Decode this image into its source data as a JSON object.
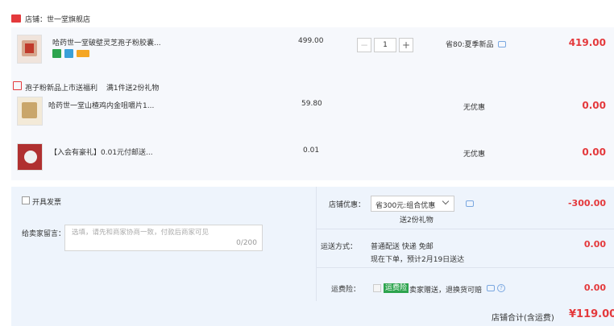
{
  "store": {
    "icon": "store-icon",
    "name": "店铺：世一堂旗舰店"
  },
  "items": [
    {
      "name": "哈药世一堂破壁灵芝孢子粉胶囊...",
      "price": "499.00",
      "quantity": "1",
      "promo": "省80:夏季新品",
      "subtotal": "419.00",
      "badges": [
        "7天",
        "保障",
        "卡"
      ]
    },
    {
      "name": "哈药世一堂山楂鸡内金咀嚼片1...",
      "price": "59.80",
      "promo": "无优惠",
      "subtotal": "0.00"
    },
    {
      "name": "【入会有豪礼】0.01元付邮送...",
      "price": "0.01",
      "promo": "无优惠",
      "subtotal": "0.00"
    }
  ],
  "gift": {
    "icon": "gift-icon",
    "text": "孢子粉新品上市送福利",
    "rule": "满1件送2份礼物"
  },
  "invoice": {
    "label": "开具发票"
  },
  "message": {
    "label": "给卖家留言：",
    "placeholder": "选填，请先和商家协商一致，付款后商家可见",
    "count": "0/200"
  },
  "discount": {
    "label": "店铺优惠：",
    "selected": "省300元:组合优惠",
    "note": "送2份礼物",
    "value": "-300.00"
  },
  "shipping": {
    "label": "运送方式：",
    "method": "普通配送 快递 免邮",
    "eta": "现在下单，预计2月19日送达",
    "value": "0.00"
  },
  "insurance": {
    "label": "运费险：",
    "tag": "运费险",
    "text": "卖家赠送，退换货可赔",
    "value": "0.00"
  },
  "total": {
    "label": "店铺合计(含运费)",
    "value": "¥119.00"
  },
  "colors": {
    "accent": "#e4393c",
    "panel": "#eef4fc"
  }
}
